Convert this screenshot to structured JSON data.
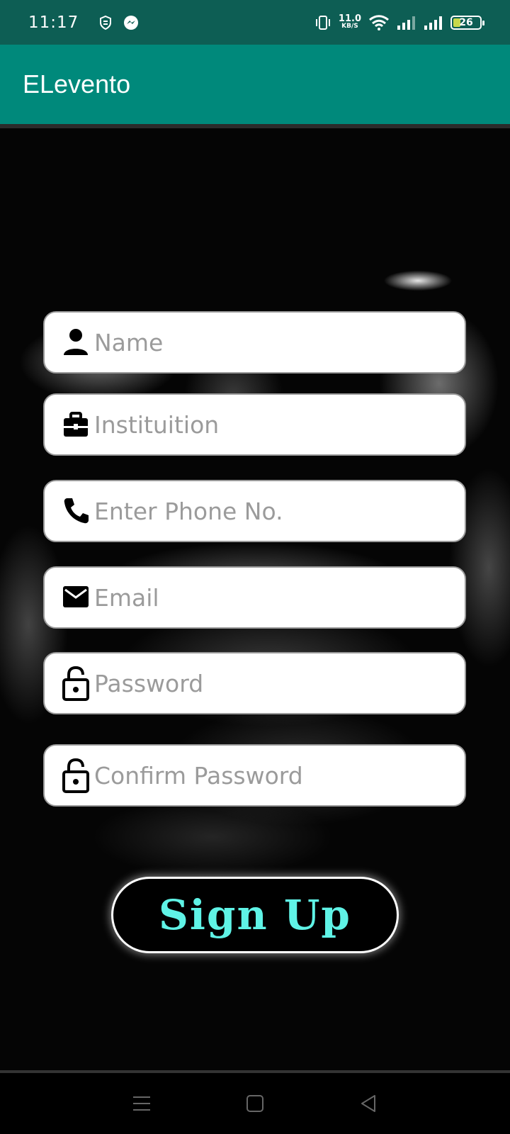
{
  "status_bar": {
    "time": "11:17",
    "net_speed_value": "11.0",
    "net_speed_unit": "KB/S",
    "battery": "26"
  },
  "app_bar": {
    "title": "ELevento"
  },
  "form": {
    "name_placeholder": "Name",
    "institution_placeholder": "Instituition",
    "phone_placeholder": "Enter Phone No.",
    "email_placeholder": "Email",
    "password_placeholder": "Password",
    "confirm_password_placeholder": "Confirm Password",
    "signup_label": "Sign Up"
  },
  "colors": {
    "status_bar": "#0d5e54",
    "app_bar": "#00897b",
    "button_text": "#5ff3e6"
  },
  "icons": {
    "name": "person-icon",
    "institution": "briefcase-icon",
    "phone": "phone-icon",
    "email": "mail-icon",
    "password": "lock-open-icon",
    "confirm_password": "lock-open-icon"
  }
}
